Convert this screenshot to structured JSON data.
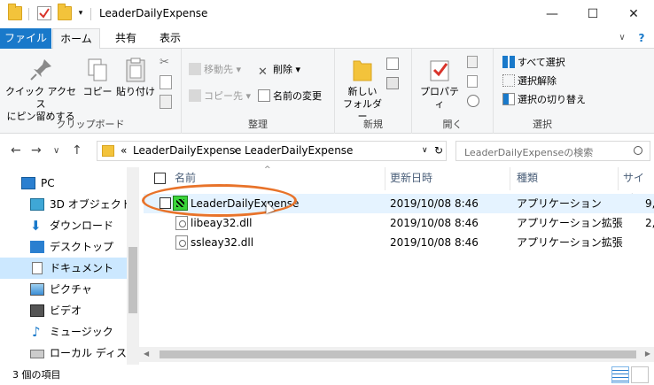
{
  "window": {
    "title": "LeaderDailyExpense",
    "minimize_icon": "—",
    "maximize_icon": "☐",
    "close_icon": "✕"
  },
  "ribbon_tabs": [
    "ファイル",
    "ホーム",
    "共有",
    "表示"
  ],
  "ribbon_help": "?",
  "ribbon_chevron": "∨",
  "ribbon": {
    "clipboard": {
      "pin_label_1": "クイック アクセス",
      "pin_label_2": "にピン留めする",
      "copy": "コピー",
      "paste": "貼り付け",
      "group": "クリップボード"
    },
    "organize": {
      "move_to": "移動先",
      "copy_to": "コピー先",
      "delete": "削除",
      "rename": "名前の変更",
      "group": "整理"
    },
    "new": {
      "new_folder_1": "新しい",
      "new_folder_2": "フォルダー",
      "group": "新規"
    },
    "open": {
      "properties": "プロパティ",
      "group": "開く"
    },
    "select": {
      "select_all": "すべて選択",
      "select_none": "選択解除",
      "invert": "選択の切り替え",
      "group": "選択"
    }
  },
  "address": {
    "back": "←",
    "forward": "→",
    "recent": "∨",
    "up": "↑",
    "overflow": "«",
    "crumbs": [
      "LeaderDailyExpense",
      "LeaderDailyExpense"
    ],
    "sep": "›",
    "dropdown": "∨",
    "refresh": "↻",
    "search_placeholder": "LeaderDailyExpenseの検索"
  },
  "sidebar": {
    "items": [
      {
        "label": "PC"
      },
      {
        "label": "3D オブジェクト"
      },
      {
        "label": "ダウンロード"
      },
      {
        "label": "デスクトップ"
      },
      {
        "label": "ドキュメント"
      },
      {
        "label": "ピクチャ"
      },
      {
        "label": "ビデオ"
      },
      {
        "label": "ミュージック"
      },
      {
        "label": "ローカル ディスク (C"
      }
    ]
  },
  "columns": {
    "name": "名前",
    "date": "更新日時",
    "type": "種類",
    "size": "サイズ"
  },
  "files": [
    {
      "name": "LeaderDailyExpense",
      "date": "2019/10/08 8:46",
      "type": "アプリケーション",
      "size": "9,"
    },
    {
      "name": "libeay32.dll",
      "date": "2019/10/08 8:46",
      "type": "アプリケーション拡張",
      "size": "2,"
    },
    {
      "name": "ssleay32.dll",
      "date": "2019/10/08 8:46",
      "type": "アプリケーション拡張",
      "size": ""
    }
  ],
  "status": {
    "count": "3 個の項目"
  },
  "colors": {
    "file_tab": "#1979ca",
    "selection": "#cce8ff",
    "annotation": "#e8732a"
  }
}
